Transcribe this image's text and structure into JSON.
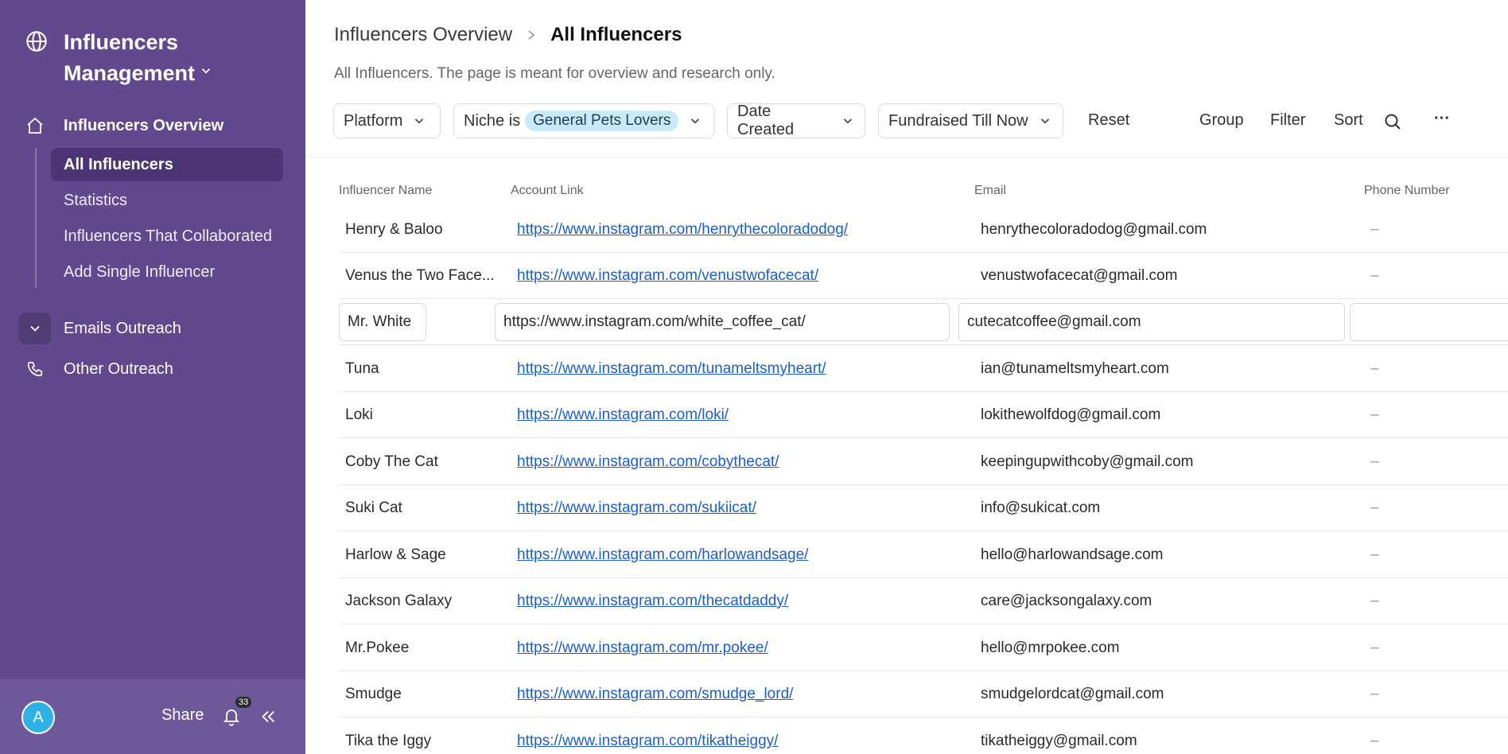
{
  "sidebar": {
    "workspace_title": "Influencers Management",
    "nav": {
      "overview": "Influencers Overview",
      "emails": "Emails Outreach",
      "other": "Other Outreach"
    },
    "subnav": [
      "All Influencers",
      "Statistics",
      "Influencers That Collaborated",
      "Add Single Influencer"
    ],
    "footer": {
      "avatar_letter": "A",
      "share_label": "Share",
      "notification_count": "33"
    }
  },
  "header": {
    "breadcrumb_parent": "Influencers Overview",
    "breadcrumb_current": "All Influencers",
    "subtitle": "All Influencers. The page is meant for overview and research only."
  },
  "toolbar": {
    "platform": "Platform",
    "niche_prefix": "Niche is",
    "niche_value": "General Pets Lovers",
    "date_created": "Date Created",
    "fundraised": "Fundraised Till Now",
    "reset": "Reset",
    "group": "Group",
    "filter": "Filter",
    "sort": "Sort",
    "more": "···"
  },
  "table": {
    "columns": [
      "Influencer Name",
      "Account Link",
      "Email",
      "Phone Number"
    ],
    "rows": [
      {
        "name": "Henry & Baloo",
        "link": "https://www.instagram.com/henrythecoloradodog/",
        "email": "henrythecoloradodog@gmail.com",
        "phone": "–"
      },
      {
        "name": "Venus the Two Face...",
        "link": "https://www.instagram.com/venustwofacecat/",
        "email": "venustwofacecat@gmail.com",
        "phone": "–"
      },
      {
        "name": "Mr. White",
        "link": "https://www.instagram.com/white_coffee_cat/",
        "email": "cutecatcoffee@gmail.com",
        "phone": ""
      },
      {
        "name": "Tuna",
        "link": "https://www.instagram.com/tunameltsmyheart/",
        "email": "ian@tunameltsmyheart.com",
        "phone": "–"
      },
      {
        "name": "Loki",
        "link": "https://www.instagram.com/loki/",
        "email": "lokithewolfdog@gmail.com",
        "phone": "–"
      },
      {
        "name": "Coby The Cat",
        "link": "https://www.instagram.com/cobythecat/",
        "email": "keepingupwithcoby@gmail.com",
        "phone": "–"
      },
      {
        "name": "Suki Cat",
        "link": "https://www.instagram.com/sukiicat/",
        "email": "info@sukicat.com",
        "phone": "–"
      },
      {
        "name": "Harlow & Sage",
        "link": "https://www.instagram.com/harlowandsage/",
        "email": "hello@harlowandsage.com",
        "phone": "–"
      },
      {
        "name": "Jackson Galaxy",
        "link": "https://www.instagram.com/thecatdaddy/",
        "email": "care@jacksongalaxy.com",
        "phone": "–"
      },
      {
        "name": "Mr.Pokee",
        "link": "https://www.instagram.com/mr.pokee/",
        "email": "hello@mrpokee.com",
        "phone": "–"
      },
      {
        "name": "Smudge",
        "link": "https://www.instagram.com/smudge_lord/",
        "email": "smudgelordcat@gmail.com",
        "phone": "–"
      },
      {
        "name": "Tika the Iggy",
        "link": "https://www.instagram.com/tikatheiggy/",
        "email": "tikatheiggy@gmail.com",
        "phone": "–"
      }
    ]
  },
  "icons": {
    "workspace": "globe-icon",
    "overview": "home-icon",
    "emails": "chevron-down-icon",
    "other": "phone-icon",
    "notifications": "bell-icon",
    "collapse": "double-chevron-left-icon",
    "search": "search-icon"
  },
  "colors": {
    "sidebar_bg": "#62488d",
    "active_item_bg": "#4c3475",
    "avatar": "#2fb1e8",
    "niche_pill": "#c9eafb",
    "link": "#1a5fc8"
  }
}
